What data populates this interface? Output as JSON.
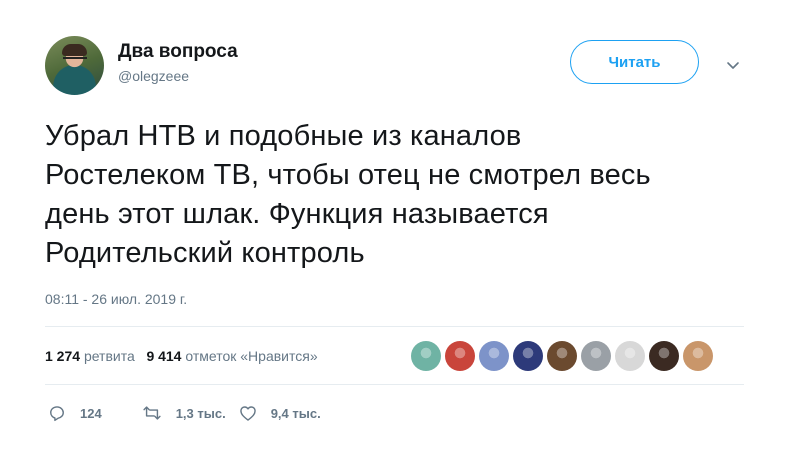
{
  "user": {
    "name": "Два вопроса",
    "handle": "@olegzeee",
    "follow_label": "Читать"
  },
  "tweet": {
    "lines": [
      "Убрал НТВ и подобные из каналов",
      "Ростелеком ТВ, чтобы отец не смотрел весь",
      "день этот шлак. Функция называется",
      "Родительский контроль"
    ],
    "timestamp": "08:11 - 26 июл. 2019 г."
  },
  "stats": {
    "retweets_count": "1 274",
    "retweets_label": "ретвита",
    "likes_count": "9 414",
    "likes_label": "отметок «Нравится»"
  },
  "likers": [
    {
      "icon": "dinosaur-avatar",
      "color": "#6fb3a4"
    },
    {
      "icon": "flags-avatar",
      "color": "#c9453b"
    },
    {
      "icon": "photo-avatar",
      "color": "#7d93c9"
    },
    {
      "icon": "photo-avatar",
      "color": "#2d3a7a"
    },
    {
      "icon": "photo-avatar",
      "color": "#6b4a2f"
    },
    {
      "icon": "photo-avatar",
      "color": "#9aa0a6"
    },
    {
      "icon": "photo-avatar",
      "color": "#d8d8d8"
    },
    {
      "icon": "photo-avatar",
      "color": "#3b2a22"
    },
    {
      "icon": "photo-avatar",
      "color": "#c9966a"
    }
  ],
  "actions": {
    "replies": "124",
    "retweets": "1,3 тыс.",
    "likes": "9,4 тыс."
  },
  "colors": {
    "accent": "#1da1f2",
    "secondary_text": "#657786",
    "primary_text": "#14171a",
    "divider": "#e6ecf0"
  }
}
